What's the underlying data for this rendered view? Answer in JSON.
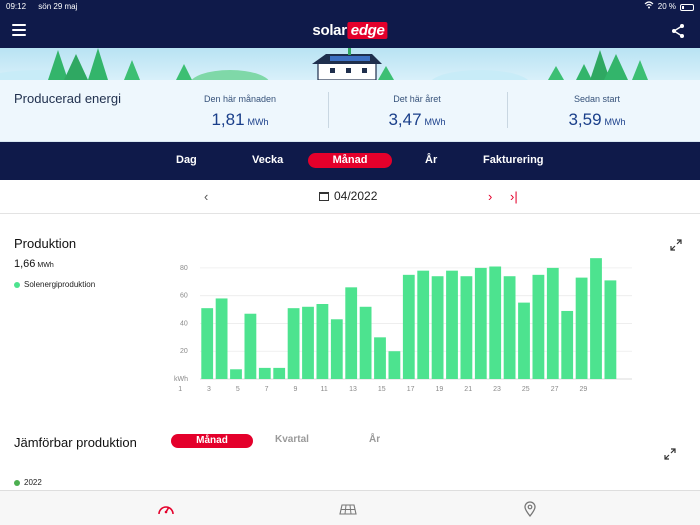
{
  "status": {
    "time": "09:12",
    "date": "sön 29 maj",
    "battery": "20 %"
  },
  "brand": {
    "part1": "solar",
    "part2": "edge"
  },
  "summary": {
    "title": "Producerad energi",
    "stats": [
      {
        "label": "Den här månaden",
        "value": "1,81",
        "unit": "MWh"
      },
      {
        "label": "Det här året",
        "value": "3,47",
        "unit": "MWh"
      },
      {
        "label": "Sedan start",
        "value": "3,59",
        "unit": "MWh"
      }
    ]
  },
  "tabs": [
    "Dag",
    "Vecka",
    "Månad",
    "År",
    "Fakturering"
  ],
  "active_tab": "Månad",
  "period": {
    "label": "04/2022"
  },
  "production": {
    "title": "Produktion",
    "total": "1,66",
    "total_unit": "MWh",
    "legend": "Solenergiproduktion",
    "color": "#4de38f"
  },
  "chart_data": {
    "type": "bar",
    "title": "",
    "xlabel": "",
    "ylabel": "kWh",
    "ylim": [
      0,
      90
    ],
    "yticks": [
      20,
      40,
      60,
      80
    ],
    "x_tick_labels": [
      "1",
      "3",
      "5",
      "7",
      "9",
      "11",
      "13",
      "15",
      "17",
      "19",
      "21",
      "23",
      "25",
      "27",
      "29"
    ],
    "categories": [
      1,
      2,
      3,
      4,
      5,
      6,
      7,
      8,
      9,
      10,
      11,
      12,
      13,
      14,
      15,
      16,
      17,
      18,
      19,
      20,
      21,
      22,
      23,
      24,
      25,
      26,
      27,
      28,
      29,
      30
    ],
    "series": [
      {
        "name": "Solenergiproduktion",
        "values": [
          51,
          58,
          7,
          47,
          8,
          8,
          51,
          52,
          54,
          43,
          66,
          52,
          30,
          20,
          75,
          78,
          74,
          78,
          74,
          80,
          81,
          74,
          55,
          75,
          80,
          49,
          73,
          87,
          71,
          0
        ],
        "color": "#4de38f"
      }
    ],
    "grid": true
  },
  "comparison": {
    "title": "Jämförbar produktion",
    "tabs": [
      "Månad",
      "Kvartal",
      "År"
    ],
    "active_tab": "Månad",
    "legend": "2022",
    "legend_color": "#4caf50"
  }
}
